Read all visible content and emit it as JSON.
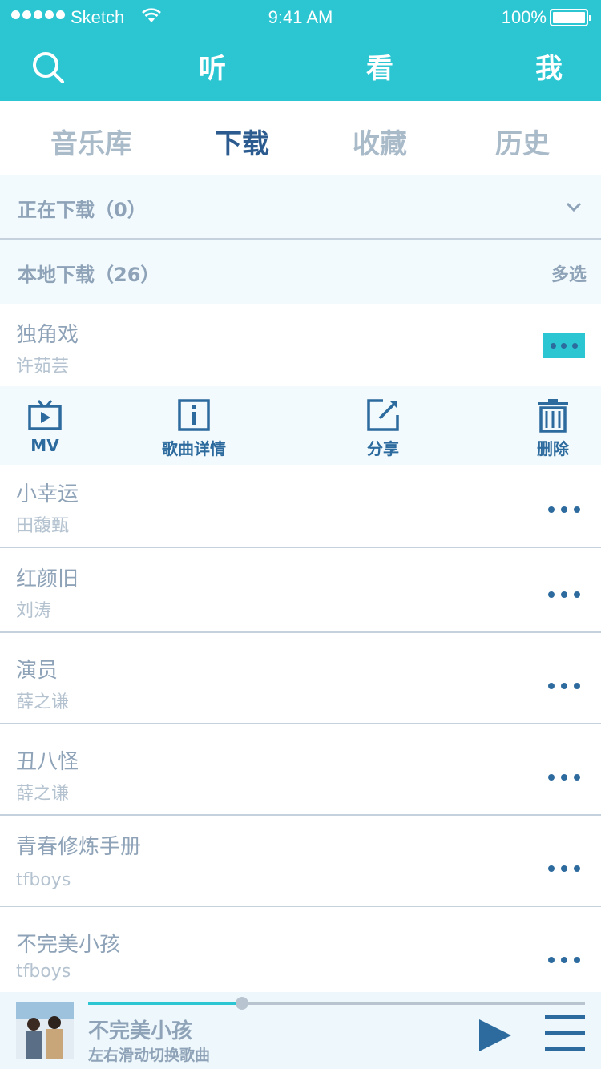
{
  "status": {
    "carrier": "Sketch",
    "time": "9:41 AM",
    "battery": "100%"
  },
  "nav": {
    "search_icon": "search-icon",
    "listen": "听",
    "watch": "看",
    "me": "我"
  },
  "tabs": [
    {
      "label": "音乐库",
      "active": false
    },
    {
      "label": "下载",
      "active": true
    },
    {
      "label": "收藏",
      "active": false
    },
    {
      "label": "历史",
      "active": false
    }
  ],
  "downloading": {
    "label": "正在下载（0）"
  },
  "local": {
    "label": "本地下载（26）",
    "multi_select": "多选"
  },
  "expanded_song": {
    "title": "独角戏",
    "artist": "许茹芸"
  },
  "actions": [
    {
      "label": "MV",
      "icon": "tv-icon"
    },
    {
      "label": "歌曲详情",
      "icon": "info-icon"
    },
    {
      "label": "分享",
      "icon": "share-icon"
    },
    {
      "label": "删除",
      "icon": "trash-icon"
    }
  ],
  "songs": [
    {
      "title": "小幸运",
      "artist": "田馥甄"
    },
    {
      "title": "红颜旧",
      "artist": "刘涛"
    },
    {
      "title": "演员",
      "artist": "薛之谦"
    },
    {
      "title": "丑八怪",
      "artist": "薛之谦"
    },
    {
      "title": "青春修炼手册",
      "artist": "tfboys"
    },
    {
      "title": "不完美小孩",
      "artist": "tfboys"
    }
  ],
  "player": {
    "title": "不完美小孩",
    "hint": "左右滑动切换歌曲",
    "progress": 0.31
  },
  "colors": {
    "accent": "#2bc6d2",
    "primary": "#2d6b9e",
    "text_muted": "#8fa3b8"
  }
}
